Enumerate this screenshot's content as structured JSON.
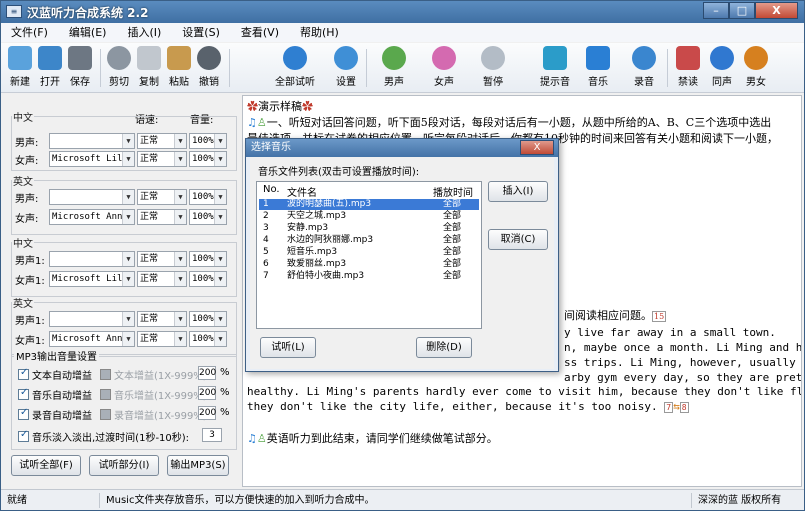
{
  "window": {
    "title": "汉蓝听力合成系统 2.2"
  },
  "menu": [
    "文件(F)",
    "编辑(E)",
    "插入(I)",
    "设置(S)",
    "查看(V)",
    "帮助(H)"
  ],
  "toolbar": [
    "新建",
    "打开",
    "保存",
    "剪切",
    "复制",
    "粘贴",
    "撤销",
    "全部试听",
    "设置",
    "男声",
    "女声",
    "暂停",
    "提示音",
    "音乐",
    "录音",
    "禁读",
    "同声",
    "男女"
  ],
  "left": {
    "groups": [
      {
        "legend": "中文",
        "rows": [
          {
            "label": "男声:",
            "voice": "",
            "speed": "正常",
            "volume": "100%"
          },
          {
            "label": "女声:",
            "voice": "Microsoft Lili",
            "speed": "正常",
            "volume": "100%"
          }
        ],
        "speed_header": "语速:",
        "volume_header": "音量:"
      },
      {
        "legend": "英文",
        "rows": [
          {
            "label": "男声:",
            "voice": "",
            "speed": "正常",
            "volume": "100%"
          },
          {
            "label": "女声:",
            "voice": "Microsoft Anna",
            "speed": "正常",
            "volume": "100%"
          }
        ]
      },
      {
        "legend": "中文",
        "rows": [
          {
            "label": "男声1:",
            "voice": "",
            "speed": "正常",
            "volume": "100%"
          },
          {
            "label": "女声1:",
            "voice": "Microsoft Lili",
            "speed": "正常",
            "volume": "100%"
          }
        ]
      },
      {
        "legend": "英文",
        "rows": [
          {
            "label": "男声1:",
            "voice": "",
            "speed": "正常",
            "volume": "100%"
          },
          {
            "label": "女声1:",
            "voice": "Microsoft Anna",
            "speed": "正常",
            "volume": "100%"
          }
        ]
      }
    ],
    "mp3": {
      "legend": "MP3输出音量设置",
      "rows": [
        {
          "label": "文本自动增益",
          "sub": "文本增益(1X-999%)",
          "value": "200",
          "unit": "%"
        },
        {
          "label": "音乐自动增益",
          "sub": "音乐增益(1X-999%)",
          "value": "200",
          "unit": "%"
        },
        {
          "label": "录音自动增益",
          "sub": "录音增益(1X-999%)",
          "value": "200",
          "unit": "%"
        }
      ],
      "fade_label": "音乐淡入淡出,过渡时间(1秒-10秒):",
      "fade_value": "3"
    },
    "buttons": [
      "试听全部(F)",
      "试听部分(I)",
      "输出MP3(S)"
    ]
  },
  "editor": {
    "heading": "演示样稿",
    "line1": "一、听短对话回答问题，听下面5段对话，每段对话后有一小题，从题中所给的A、B、C三个选项中选出",
    "line2a": "最佳选项，并标在试卷的相应位置。听完每段对话后，你都有10秒钟的时间来回答有关小题和阅读下一小题，",
    "line_mid": "间阅读相应问题。",
    "e1": "y live far away in a small town.",
    "e2": "n, maybe once a month.  Li Ming and his",
    "e3": "ss trips.  Li Ming, however, usually",
    "e4": "arby gym every day, so they are pretty",
    "e5": "healthy.  Li Ming's parents hardly ever come to visit him, because they don't like flying, and",
    "e6": "they don't like the city life, either, because it's too noisy.",
    "end": "英语听力到此结束，请同学们继续做笔试部分。"
  },
  "dialog": {
    "title": "选择音乐",
    "close": "X",
    "list_label": "音乐文件列表(双击可设置播放时间):",
    "headers": [
      "No.",
      "文件名",
      "播放时间"
    ],
    "items": [
      {
        "no": "1",
        "name": "波的明瑟曲(五).mp3",
        "time": "全部"
      },
      {
        "no": "2",
        "name": "天空之城.mp3",
        "time": "全部"
      },
      {
        "no": "3",
        "name": "安静.mp3",
        "time": "全部"
      },
      {
        "no": "4",
        "name": "水边的阿狄丽娜.mp3",
        "time": "全部"
      },
      {
        "no": "5",
        "name": "短音乐.mp3",
        "time": "全部"
      },
      {
        "no": "6",
        "name": "致爱丽丝.mp3",
        "time": "全部"
      },
      {
        "no": "7",
        "name": "舒伯特小夜曲.mp3",
        "time": "全部"
      }
    ],
    "insert": "插入(I)",
    "cancel": "取消(C)",
    "listen": "试听(L)",
    "delete": "删除(D)"
  },
  "status": {
    "left": "就绪",
    "mid": "Music文件夹存放音乐，可以方便快速的加入到听力合成中。",
    "right": "深深的蓝 版权所有"
  }
}
